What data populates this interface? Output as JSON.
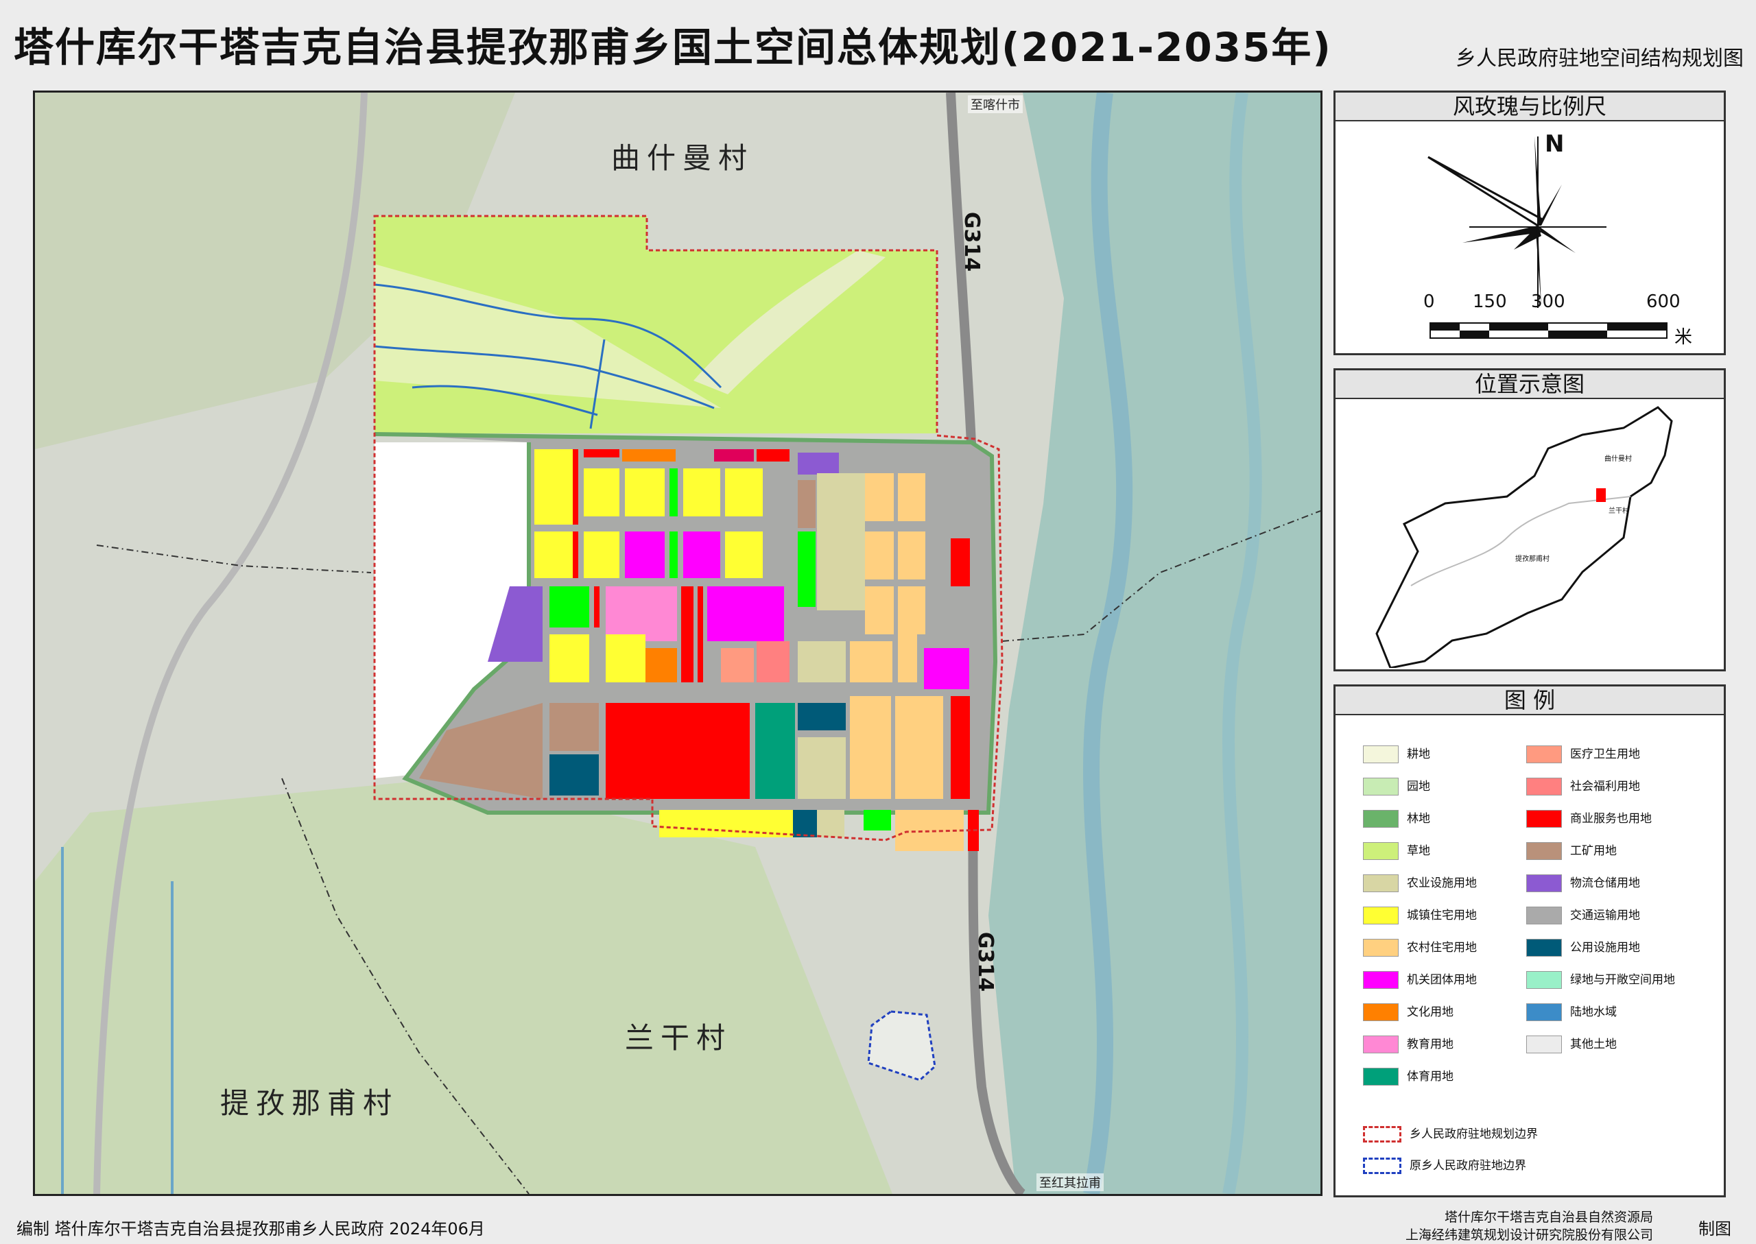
{
  "header": {
    "title": "塔什库尔干塔吉克自治县提孜那甫乡国土空间总体规划(2021-2035年)",
    "subtitle": "乡人民政府驻地空间结构规划图"
  },
  "map": {
    "village_labels": [
      "曲什曼村",
      "兰干村",
      "提孜那甫村"
    ],
    "road_labels": {
      "north": "至喀什市",
      "south": "至红其拉甫"
    },
    "highway": "G314"
  },
  "compass": {
    "title": "风玫瑰与比例尺",
    "north": "N",
    "scale_ticks": [
      "0",
      "150",
      "300",
      "600"
    ],
    "scale_unit": "米"
  },
  "location": {
    "title": "位置示意图",
    "labels": [
      "曲什曼村",
      "兰干村",
      "提孜那甫村"
    ]
  },
  "legend": {
    "title": "图    例",
    "left_items": [
      {
        "label": "耕地",
        "color": "#f4f6dc"
      },
      {
        "label": "园地",
        "color": "#c8ecb4"
      },
      {
        "label": "林地",
        "color": "#6ab36a"
      },
      {
        "label": "草地",
        "color": "#cdf07a"
      },
      {
        "label": "农业设施用地",
        "color": "#d8d6a4"
      },
      {
        "label": "城镇住宅用地",
        "color": "#ffff33"
      },
      {
        "label": "农村住宅用地",
        "color": "#ffd080"
      },
      {
        "label": "机关团体用地",
        "color": "#ff00ff"
      },
      {
        "label": "文化用地",
        "color": "#ff8000"
      },
      {
        "label": "教育用地",
        "color": "#ff88d4"
      },
      {
        "label": "体育用地",
        "color": "#00a07a"
      }
    ],
    "right_items": [
      {
        "label": "医疗卫生用地",
        "color": "#ff9a80"
      },
      {
        "label": "社会福利用地",
        "color": "#ff8080"
      },
      {
        "label": "商业服务也用地",
        "color": "#ff0000"
      },
      {
        "label": "工矿用地",
        "color": "#b9917a"
      },
      {
        "label": "物流仓储用地",
        "color": "#8c5ad2"
      },
      {
        "label": "交通运输用地",
        "color": "#aaaaaa"
      },
      {
        "label": "公用设施用地",
        "color": "#005a78"
      },
      {
        "label": "绿地与开敞空间用地",
        "color": "#99f0c8"
      },
      {
        "label": "陆地水域",
        "color": "#3c8cc8"
      },
      {
        "label": "其他土地",
        "color": "#ececec"
      }
    ],
    "boundary_items": [
      {
        "label": "乡人民政府驻地规划边界",
        "color": "#d03030"
      },
      {
        "label": "原乡人民政府驻地边界",
        "color": "#2040c0"
      }
    ]
  },
  "footer": {
    "left": "编制   塔什库尔干塔吉克自治县提孜那甫乡人民政府 2024年06月",
    "right_line1": "塔什库尔干塔吉克自治县自然资源局",
    "right_line2": "上海经纬建筑规划设计研究院股份有限公司",
    "sign": "制图"
  }
}
